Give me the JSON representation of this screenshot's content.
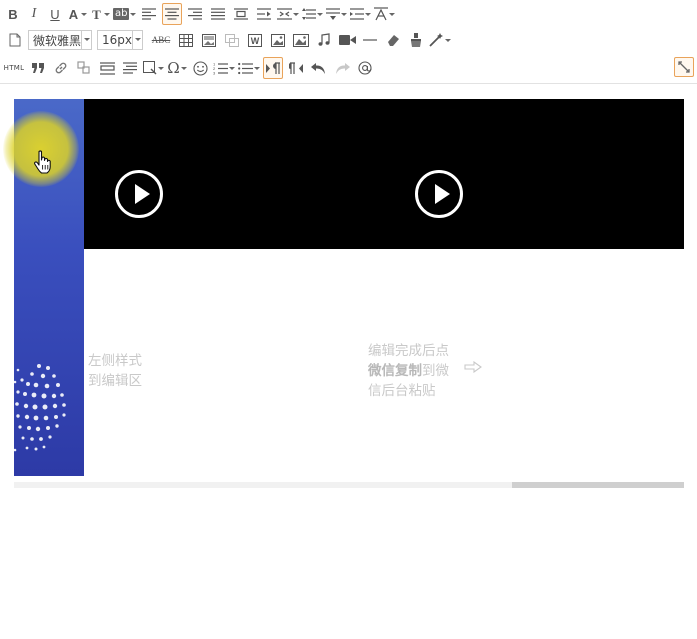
{
  "toolbar": {
    "font_family": "微软雅黑",
    "font_size": "16px",
    "html_label": "HTML",
    "strike_label": "ABC",
    "bold_label": "B",
    "italic_label": "I",
    "underline_label": "U",
    "font_color_label": "A",
    "format_label": "T",
    "highlight_label": "ab"
  },
  "content": {
    "left_text_line1": "左侧样式",
    "left_text_line2": "到编辑区",
    "right_text_line1": "编辑完成后点",
    "right_text_bold": "微信复制",
    "right_text_line2_rest": "到微",
    "right_text_line3": "信后台粘贴"
  },
  "colors": {
    "accent": "#e9a35a",
    "banner": "#3a4fbe",
    "video_bg": "#000000",
    "cursor_highlight": "#dcd228"
  }
}
